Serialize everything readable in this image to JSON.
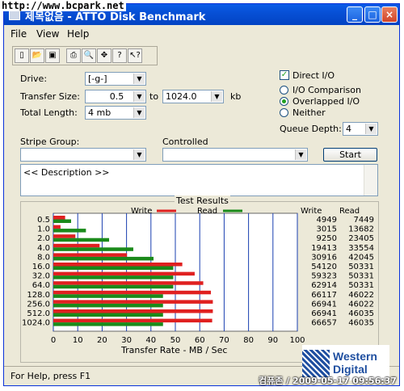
{
  "watermark": "http://www.bcpark.net",
  "window": {
    "title": "제목없음 - ATTO Disk Benchmark"
  },
  "menu": [
    "File",
    "View",
    "Help"
  ],
  "toolbar_icons": [
    "new-icon",
    "open-icon",
    "save-icon",
    "print-icon",
    "preview-icon",
    "move-icon",
    "help-icon",
    "context-help-icon"
  ],
  "form": {
    "drive_label": "Drive:",
    "drive_value": "[-g-]",
    "transfer_size_label": "Transfer Size:",
    "transfer_from": "0.5",
    "to_label": "to",
    "transfer_to": "1024.0",
    "unit": "kb",
    "total_length_label": "Total Length:",
    "total_length": "4 mb",
    "direct_io_label": "Direct I/O",
    "io_comparison_label": "I/O Comparison",
    "overlapped_label": "Overlapped I/O",
    "neither_label": "Neither",
    "queue_depth_label": "Queue Depth:",
    "queue_depth": "4",
    "stripe_group_label": "Stripe Group:",
    "controlled_label": "Controlled",
    "start_label": "Start",
    "description": "<< Description >>"
  },
  "results": {
    "title": "Test Results",
    "write_legend": "Write",
    "read_legend": "Read",
    "write_header": "Write",
    "read_header": "Read",
    "xlabel": "Transfer Rate - MB / Sec"
  },
  "chart_data": {
    "type": "bar",
    "categories": [
      "0.5",
      "1.0",
      "2.0",
      "4.0",
      "8.0",
      "16.0",
      "32.0",
      "64.0",
      "128.0",
      "256.0",
      "512.0",
      "1024.0"
    ],
    "series": [
      {
        "name": "Write",
        "color": "#e02020",
        "values": [
          4949,
          3015,
          9250,
          19413,
          30916,
          54120,
          59323,
          62914,
          66117,
          66941,
          66941,
          66657
        ]
      },
      {
        "name": "Read",
        "color": "#1a8a1a",
        "values": [
          7449,
          13682,
          23405,
          33554,
          42045,
          50331,
          50331,
          50331,
          46022,
          46022,
          46035,
          46035
        ]
      }
    ],
    "x_ticks": [
      "0",
      "10",
      "20",
      "30",
      "40",
      "50",
      "60",
      "70",
      "80",
      "90",
      "100"
    ],
    "xlim": [
      0,
      100
    ],
    "xlabel": "Transfer Rate - MB / Sec",
    "legend": "top"
  },
  "status": "For Help, press F1",
  "brand": [
    "Western",
    "Digital"
  ],
  "stamp": "컴퓨존 / 2009-05-17 09:56:37"
}
